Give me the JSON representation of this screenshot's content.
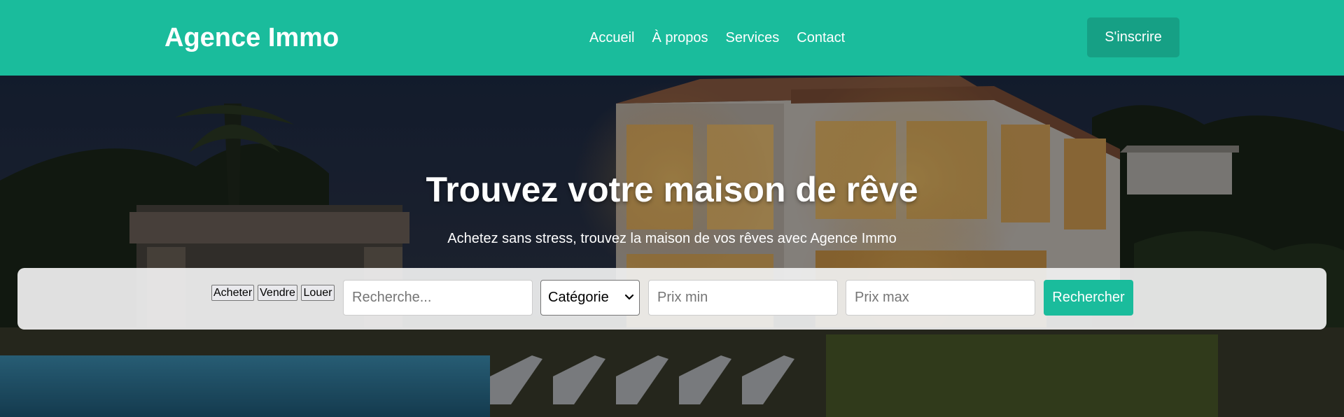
{
  "header": {
    "logo": "Agence Immo",
    "nav": [
      "Accueil",
      "À propos",
      "Services",
      "Contact"
    ],
    "signup_label": "S'inscrire"
  },
  "hero": {
    "title": "Trouvez votre maison de rêve",
    "subtitle": "Achetez sans stress, trouvez la maison de vos rêves avec Agence Immo",
    "background_image": "villa-pool-at-dusk"
  },
  "search": {
    "tabs": [
      "Acheter",
      "Vendre",
      "Louer"
    ],
    "query_placeholder": "Recherche...",
    "category_selected": "Catégorie",
    "price_min_placeholder": "Prix min",
    "price_max_placeholder": "Prix max",
    "submit_label": "Rechercher"
  },
  "colors": {
    "brand": "#1abc9c",
    "brand_dark": "#16a085",
    "white": "#ffffff"
  }
}
